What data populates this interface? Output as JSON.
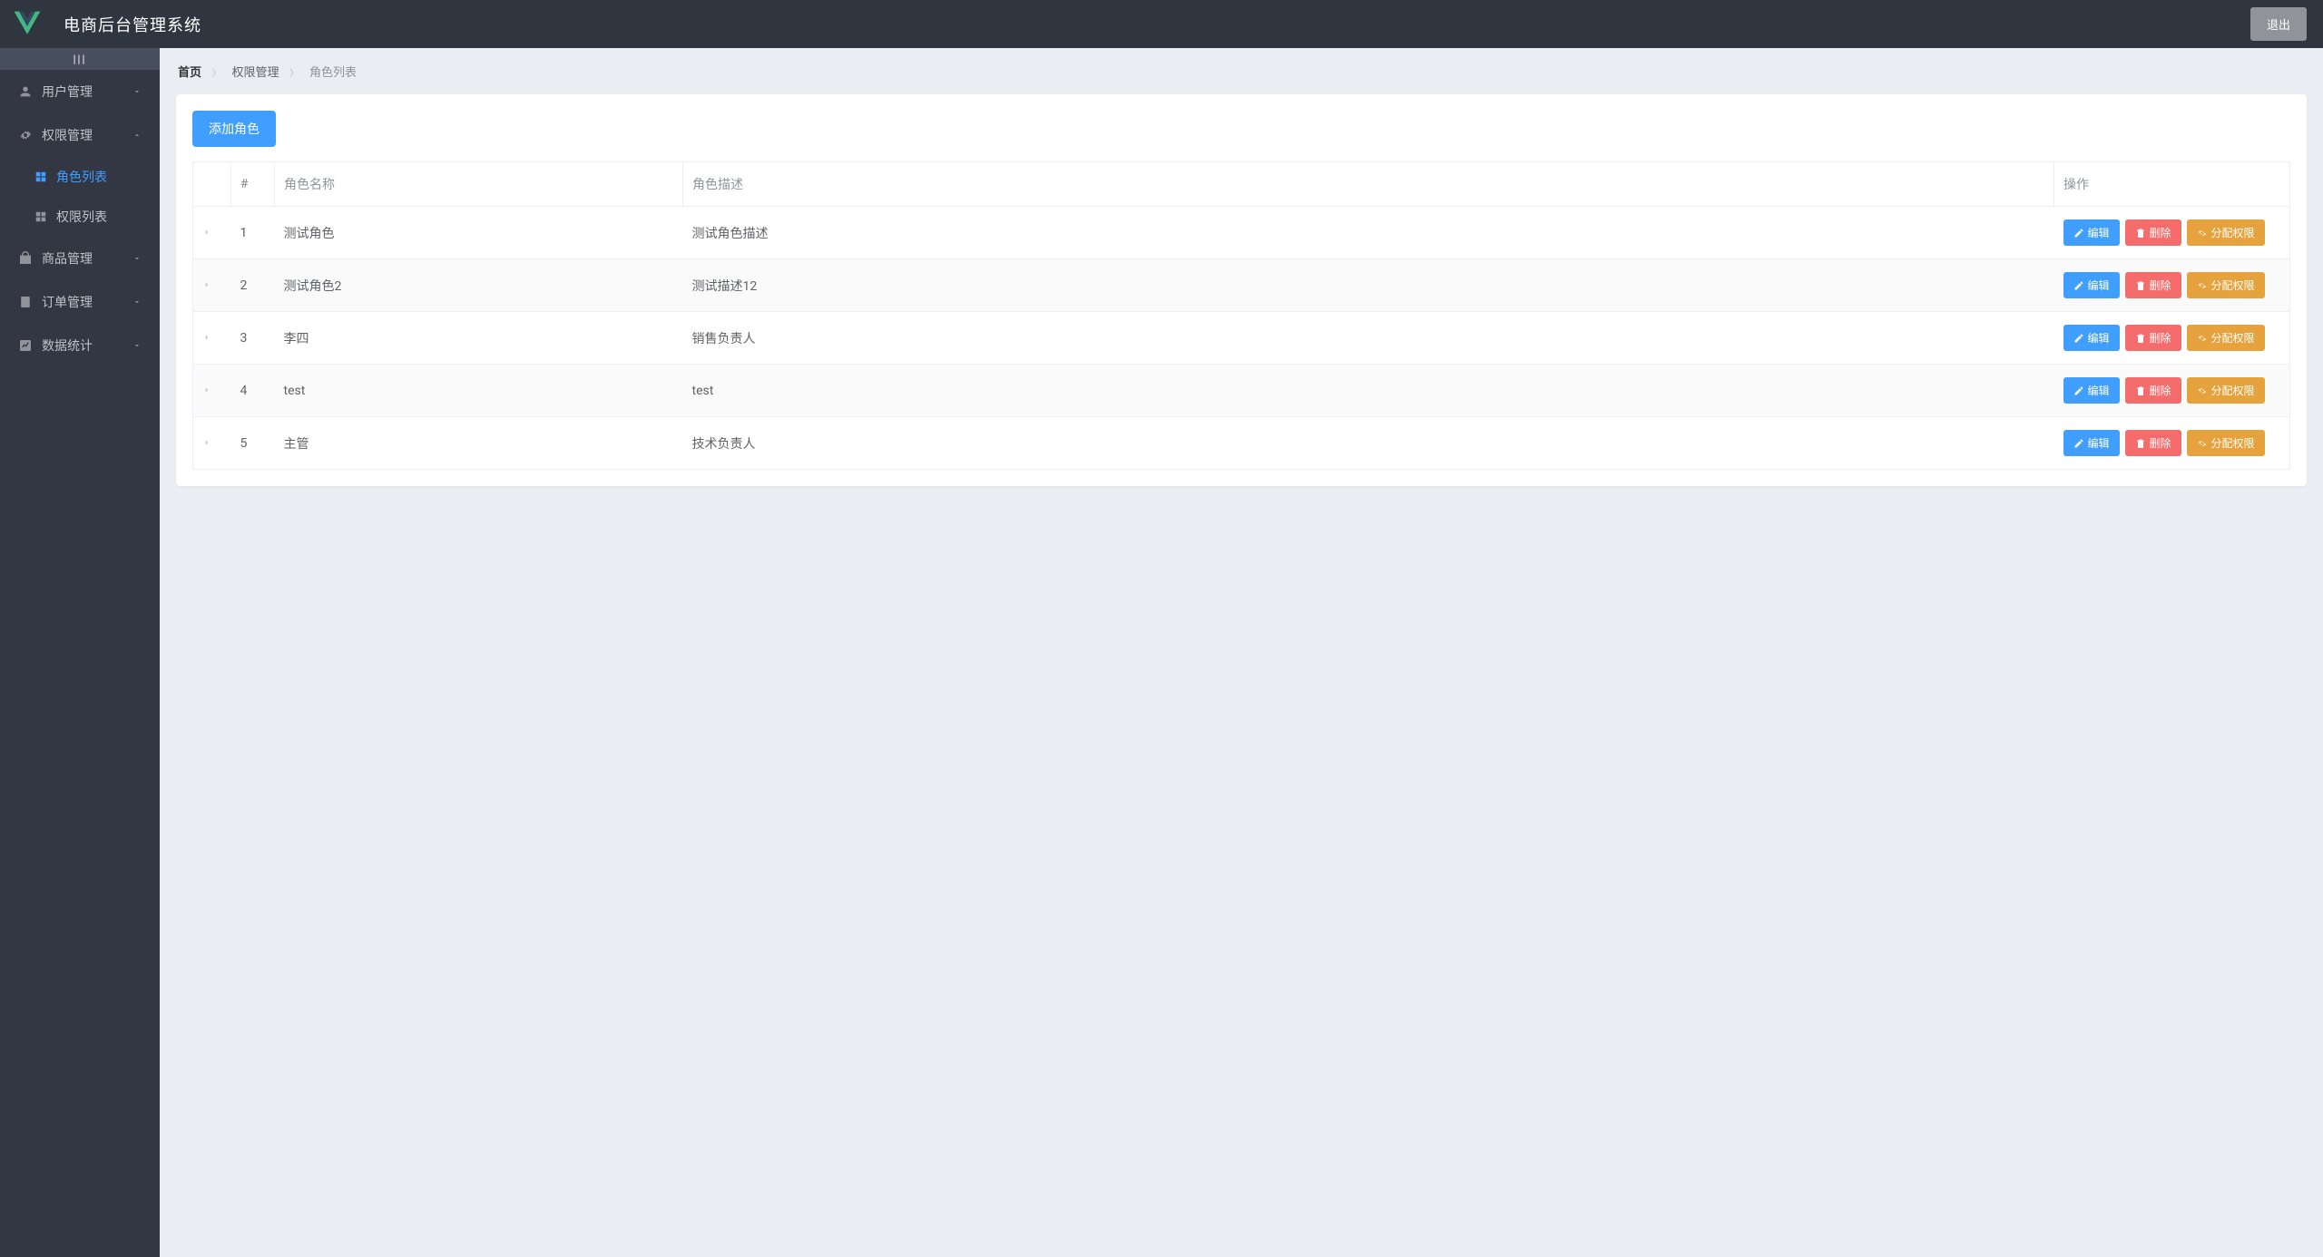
{
  "header": {
    "title": "电商后台管理系统",
    "logout": "退出"
  },
  "sidebar": {
    "collapse_glyph": "|||",
    "items": [
      {
        "key": "users",
        "label": "用户管理",
        "open": false
      },
      {
        "key": "rights",
        "label": "权限管理",
        "open": true,
        "children": [
          {
            "key": "roles",
            "label": "角色列表",
            "active": true
          },
          {
            "key": "perms",
            "label": "权限列表",
            "active": false
          }
        ]
      },
      {
        "key": "goods",
        "label": "商品管理",
        "open": false
      },
      {
        "key": "orders",
        "label": "订单管理",
        "open": false
      },
      {
        "key": "stats",
        "label": "数据统计",
        "open": false
      }
    ]
  },
  "breadcrumb": {
    "home": "首页",
    "mid": "权限管理",
    "last": "角色列表"
  },
  "actions": {
    "add_role": "添加角色",
    "edit": "编辑",
    "delete": "删除",
    "assign": "分配权限"
  },
  "table": {
    "headers": {
      "index": "#",
      "name": "角色名称",
      "desc": "角色描述",
      "ops": "操作"
    },
    "rows": [
      {
        "idx": "1",
        "name": "测试角色",
        "desc": "测试角色描述"
      },
      {
        "idx": "2",
        "name": "测试角色2",
        "desc": "测试描述12"
      },
      {
        "idx": "3",
        "name": "李四",
        "desc": "销售负责人"
      },
      {
        "idx": "4",
        "name": "test",
        "desc": "test"
      },
      {
        "idx": "5",
        "name": "主管",
        "desc": "技术负责人"
      }
    ]
  }
}
